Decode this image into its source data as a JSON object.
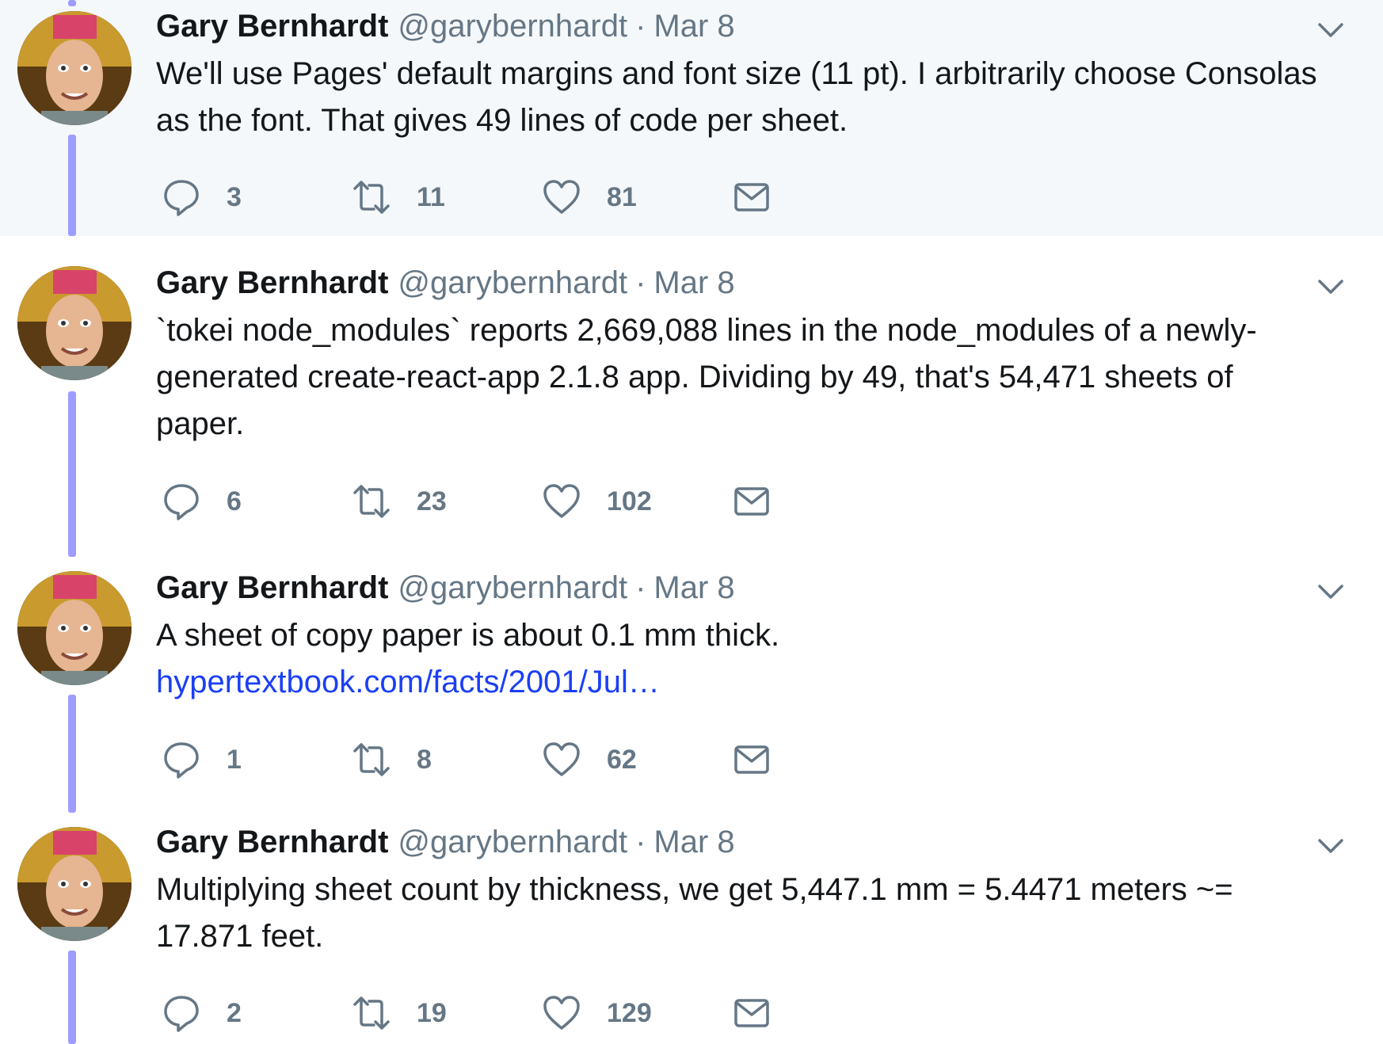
{
  "colors": {
    "thread_line": "#9d9dff",
    "highlight_bg": "#f5f8fa",
    "link": "#1b3ff5",
    "muted": "#657786"
  },
  "tweets": [
    {
      "name": "Gary Bernhardt",
      "handle": "@garybernhardt",
      "sep": "·",
      "date": "Mar 8",
      "text": "We'll use Pages' default margins and font size (11 pt). I arbitrarily choose Consolas as the font. That gives 49 lines of code per sheet.",
      "link": "",
      "replies": "3",
      "retweets": "11",
      "likes": "81"
    },
    {
      "name": "Gary Bernhardt",
      "handle": "@garybernhardt",
      "sep": "·",
      "date": "Mar 8",
      "text": "`tokei node_modules` reports 2,669,088 lines in the node_modules of a newly-generated create-react-app 2.1.8 app. Dividing by 49, that's 54,471 sheets of paper.",
      "link": "",
      "replies": "6",
      "retweets": "23",
      "likes": "102"
    },
    {
      "name": "Gary Bernhardt",
      "handle": "@garybernhardt",
      "sep": "·",
      "date": "Mar 8",
      "text": "A sheet of copy paper is about 0.1 mm thick.",
      "link": "hypertextbook.com/facts/2001/Jul…",
      "replies": "1",
      "retweets": "8",
      "likes": "62"
    },
    {
      "name": "Gary Bernhardt",
      "handle": "@garybernhardt",
      "sep": "·",
      "date": "Mar 8",
      "text": "Multiplying sheet count by thickness, we get 5,447.1 mm = 5.4471 meters ~= 17.871 feet.",
      "link": "",
      "replies": "2",
      "retweets": "19",
      "likes": "129"
    }
  ]
}
